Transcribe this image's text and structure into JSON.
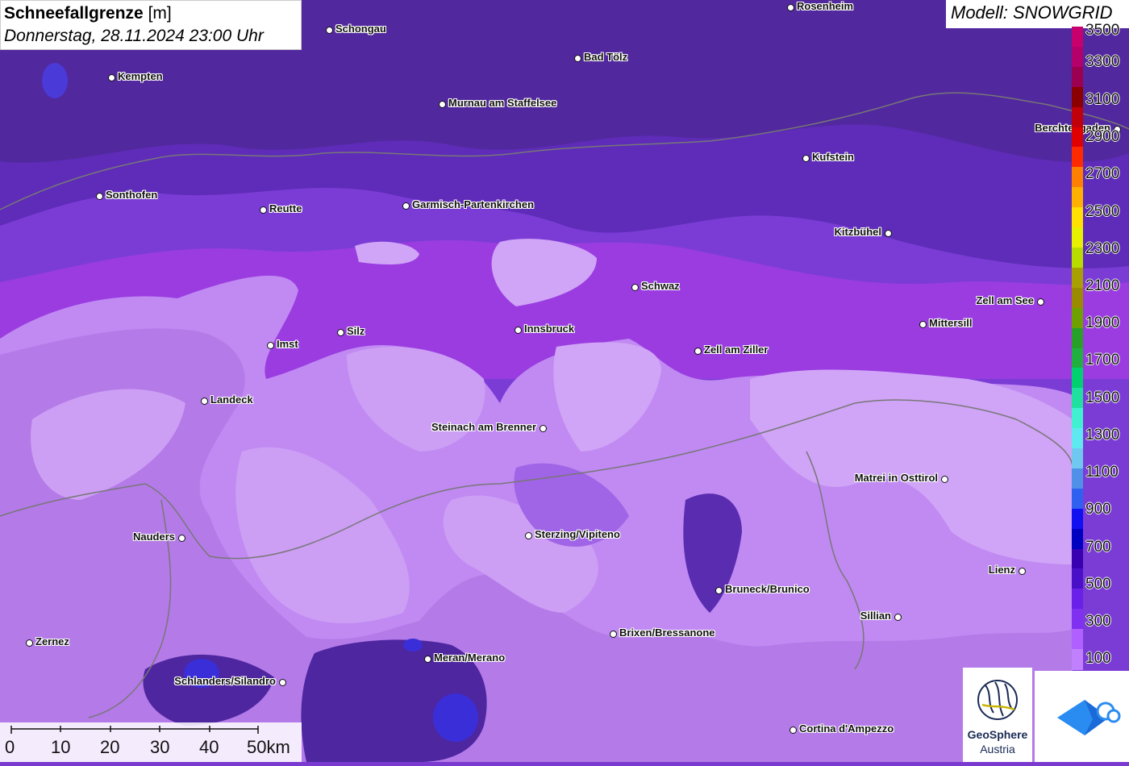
{
  "title": {
    "name": "Schneefallgrenze",
    "unit": "[m]",
    "datetime": "Donnerstag, 28.11.2024 23:00 Uhr"
  },
  "model": "Modell: SNOWGRID",
  "legend": {
    "labels": [
      "3500",
      "3300",
      "3100",
      "2900",
      "2700",
      "2500",
      "2300",
      "2100",
      "1900",
      "1700",
      "1500",
      "1300",
      "1100",
      "900",
      "700",
      "500",
      "300",
      "100"
    ],
    "colors": [
      "#c8006e",
      "#b3006a",
      "#9c0050",
      "#8a0000",
      "#c0000a",
      "#e00000",
      "#ff2a00",
      "#ff8000",
      "#ffb000",
      "#ffe000",
      "#e6f000",
      "#b8dc00",
      "#a8a000",
      "#9a8a00",
      "#6ea000",
      "#28a028",
      "#20b040",
      "#00d070",
      "#20e0a0",
      "#40f0d0",
      "#60e8f0",
      "#70c8f0",
      "#5090e8",
      "#3060f0",
      "#1010f0",
      "#0000c0",
      "#3800b0",
      "#4a10c8",
      "#6a20e8",
      "#8030f0",
      "#b060ff",
      "#c080ff"
    ]
  },
  "cities": [
    {
      "name": "Schongau"
    },
    {
      "name": "Rosenheim"
    },
    {
      "name": "Kempten"
    },
    {
      "name": "Bad Tölz"
    },
    {
      "name": "Murnau am Staffelsee"
    },
    {
      "name": "Berchtesgaden"
    },
    {
      "name": "Kufstein"
    },
    {
      "name": "Sonthofen"
    },
    {
      "name": "Reutte"
    },
    {
      "name": "Garmisch-Partenkirchen"
    },
    {
      "name": "Kitzbühel"
    },
    {
      "name": "Schwaz"
    },
    {
      "name": "Zell am See"
    },
    {
      "name": "Silz"
    },
    {
      "name": "Innsbruck"
    },
    {
      "name": "Mittersill"
    },
    {
      "name": "Imst"
    },
    {
      "name": "Zell am Ziller"
    },
    {
      "name": "Landeck"
    },
    {
      "name": "Steinach am Brenner"
    },
    {
      "name": "Matrei in Osttirol"
    },
    {
      "name": "Nauders"
    },
    {
      "name": "Sterzing/Vipiteno"
    },
    {
      "name": "Lienz"
    },
    {
      "name": "Bruneck/Brunico"
    },
    {
      "name": "Sillian"
    },
    {
      "name": "Brixen/Bressanone"
    },
    {
      "name": "Zernez"
    },
    {
      "name": "Meran/Merano"
    },
    {
      "name": "Schlanders/Silandro"
    },
    {
      "name": "Cortina d'Ampezzo"
    }
  ],
  "scale": {
    "labels": [
      "0",
      "10",
      "20",
      "30",
      "40",
      "50km"
    ]
  },
  "logos": {
    "geosphere_line1": "GeoSphere",
    "geosphere_line2": "Austria"
  }
}
